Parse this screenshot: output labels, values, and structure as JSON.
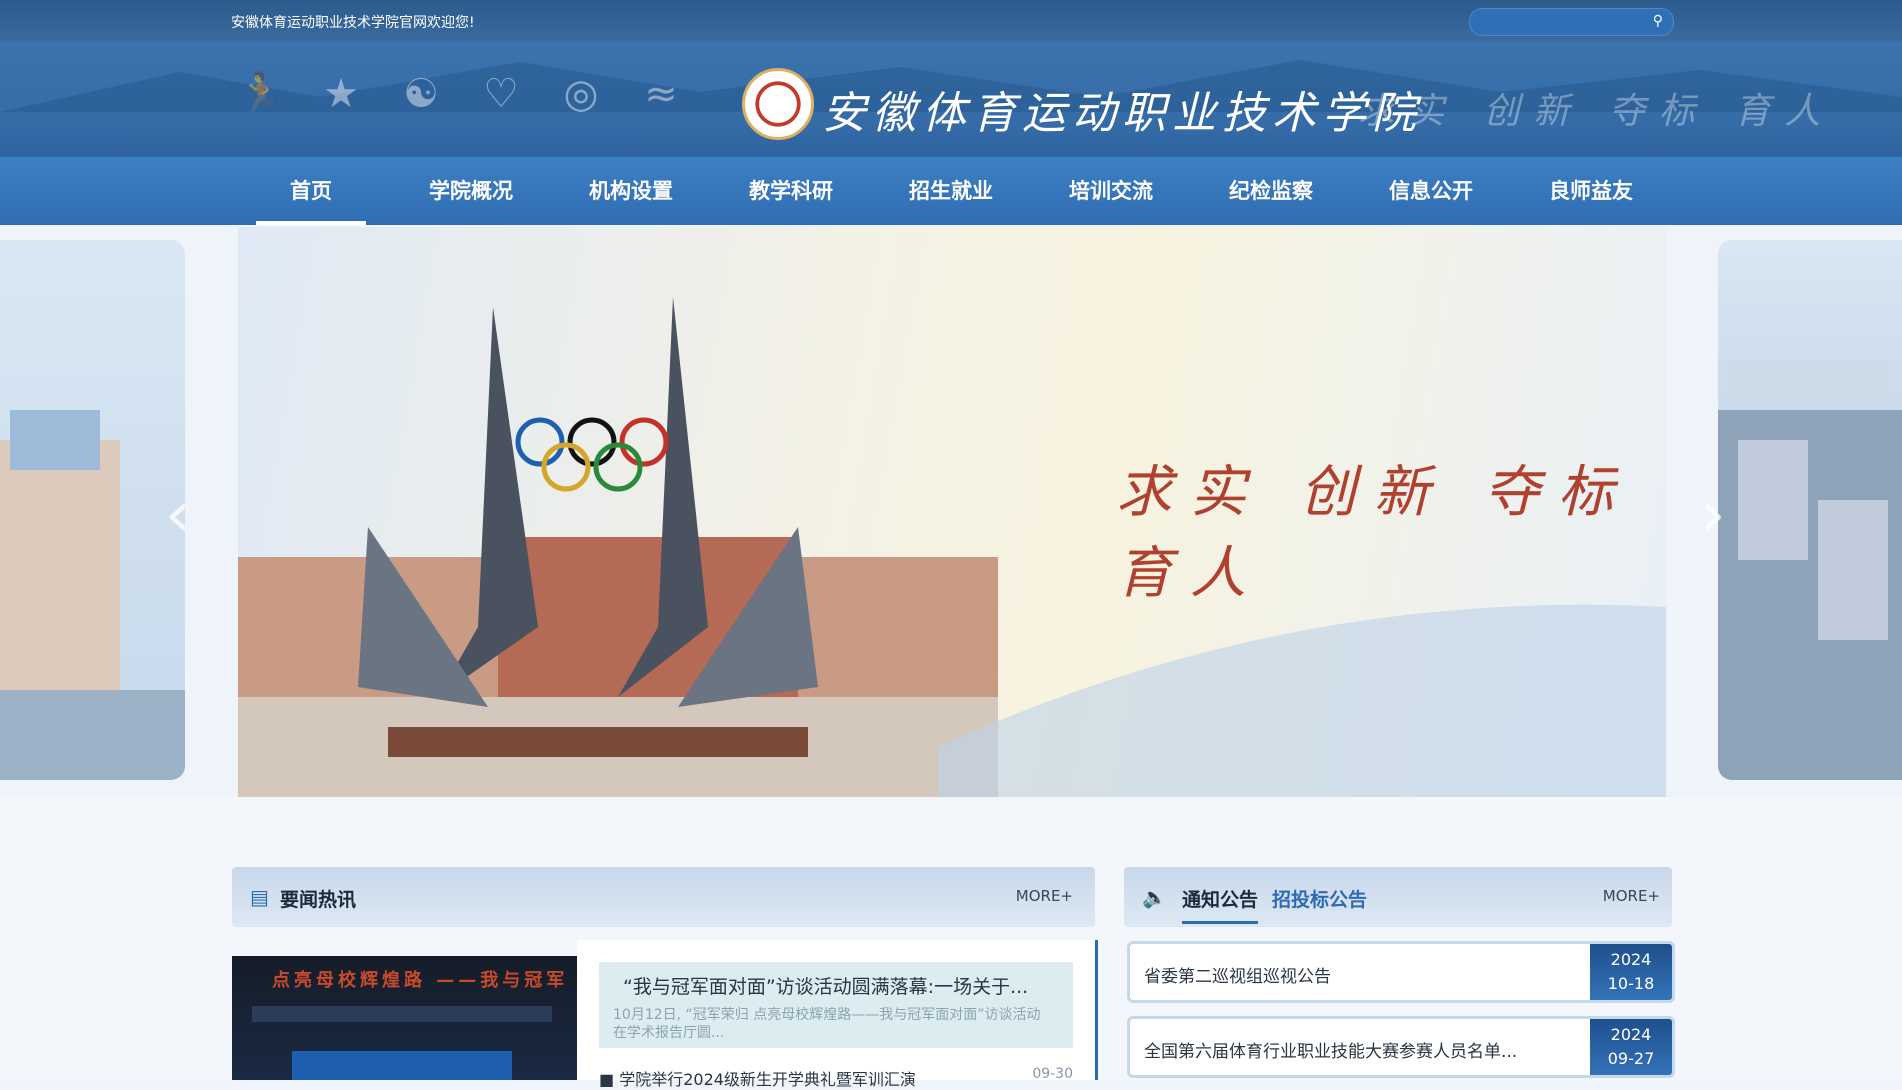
{
  "topbar": {
    "welcome": "安徽体育运动职业技术学院官网欢迎您!",
    "search_placeholder": "",
    "search_icon": "search-icon"
  },
  "header": {
    "school_name": "安徽体育运动职业技术学院",
    "motto": "求实 创新 夺标 育人",
    "sport_icons": [
      "athletics-icon",
      "team-icon",
      "gymnastics-icon",
      "jump-icon",
      "cycling-icon",
      "swimming-icon"
    ]
  },
  "nav": {
    "items": [
      {
        "label": "首页",
        "active": true
      },
      {
        "label": "学院概况"
      },
      {
        "label": "机构设置"
      },
      {
        "label": "教学科研"
      },
      {
        "label": "招生就业"
      },
      {
        "label": "培训交流"
      },
      {
        "label": "纪检监察"
      },
      {
        "label": "信息公开"
      },
      {
        "label": "良师益友"
      }
    ]
  },
  "banner": {
    "motto": "求实 创新 夺标 育人"
  },
  "news": {
    "title": "要闻热讯",
    "more": "MORE+",
    "image_caption": "点亮母校辉煌路 ——我与冠军",
    "featured_title": "“我与冠军面对面”访谈活动圆满落幕:一场关于...",
    "featured_desc": "10月12日, “冠军荣归 点亮母校辉煌路——我与冠军面对面”访谈活动在学术报告厅圆...",
    "items": [
      {
        "title": "学院举行2024级新生开学典礼暨军训汇演",
        "date": "09-30"
      }
    ]
  },
  "notices": {
    "tab_active": "通知公告",
    "tab_other": "招投标公告",
    "more": "MORE+",
    "items": [
      {
        "title": "省委第二巡视组巡视公告",
        "year": "2024",
        "date": "10-18"
      },
      {
        "title": "全国第六届体育行业职业技能大赛参赛人员名单...",
        "year": "2024",
        "date": "09-27"
      }
    ]
  },
  "colors": {
    "primary": "#2d6bb3",
    "nav_bg": "#3d7fc4",
    "date_badge": "#1e4f8c"
  }
}
